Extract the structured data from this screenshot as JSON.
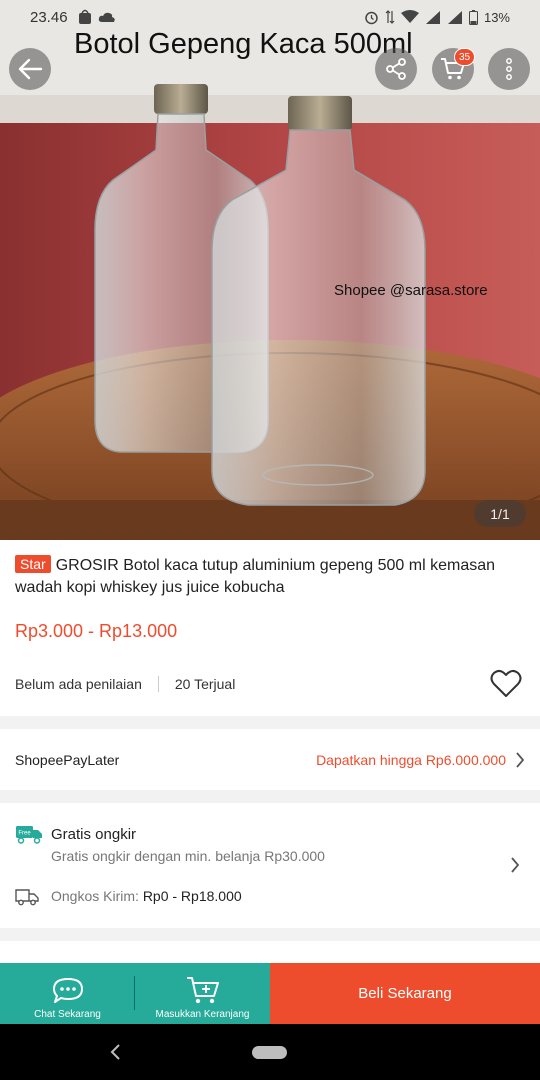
{
  "status_bar": {
    "time": "23.46",
    "battery": "13%"
  },
  "header": {
    "overlay_title": "Botol Gepeng Kaca 500ml",
    "cart_badge": "35"
  },
  "gallery": {
    "watermark": "Shopee @sarasa.store",
    "counter": "1/1"
  },
  "product": {
    "badge": "Star",
    "title": "GROSIR Botol kaca tutup aluminium gepeng 500 ml kemasan wadah kopi whiskey jus juice kobucha",
    "price": "Rp3.000 - Rp13.000",
    "rating": "Belum ada penilaian",
    "sold": "20 Terjual"
  },
  "paylater": {
    "label": "ShopeePayLater",
    "promo": "Dapatkan hingga Rp6.000.000"
  },
  "shipping": {
    "free_title": "Gratis ongkir",
    "free_subtitle": "Gratis ongkir dengan min. belanja Rp30.000",
    "free_icon_text": "Free",
    "cost_label": "Ongkos Kirim:",
    "cost_value": "Rp0 - Rp18.000"
  },
  "bottom_bar": {
    "chat_label": "Chat Sekarang",
    "cart_label": "Masukkan Keranjang",
    "buy_label": "Beli Sekarang"
  },
  "colors": {
    "accent": "#ee4d2d",
    "teal": "#26aa99"
  },
  "icons": {
    "back": "back-arrow-icon",
    "share": "share-icon",
    "cart": "cart-icon",
    "more": "more-vertical-icon",
    "heart": "heart-outline-icon",
    "chevron": "chevron-right-icon",
    "free_shipping": "free-shipping-icon",
    "truck": "truck-icon",
    "chat": "chat-bubble-icon",
    "add_to_cart": "add-to-cart-icon"
  }
}
